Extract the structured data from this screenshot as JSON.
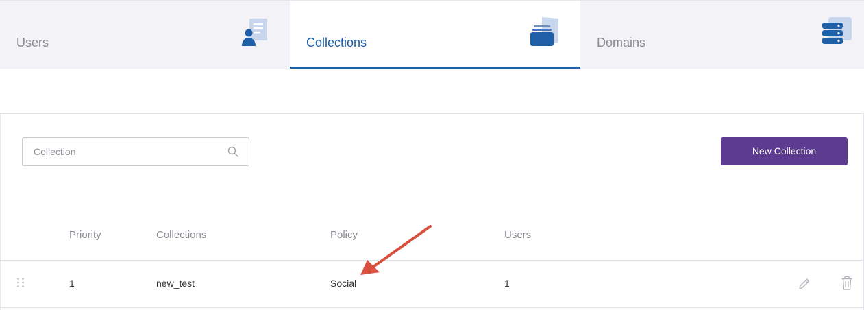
{
  "tabs": [
    {
      "label": "Users",
      "icon": "user-document-icon"
    },
    {
      "label": "Collections",
      "icon": "folder-stack-icon",
      "active": true
    },
    {
      "label": "Domains",
      "icon": "server-stack-icon"
    }
  ],
  "toolbar": {
    "search_placeholder": "Collection",
    "search_value": "",
    "new_button_label": "New Collection"
  },
  "table": {
    "columns": [
      "Priority",
      "Collections",
      "Policy",
      "Users"
    ],
    "rows": [
      {
        "priority": "1",
        "collection": "new_test",
        "policy": "Social",
        "users": "1"
      }
    ]
  },
  "colors": {
    "accent": "#1f5fa8",
    "primary_button": "#5d3b91",
    "annotation_arrow": "#d9503f",
    "tab_bar": "#f3f3f7"
  }
}
